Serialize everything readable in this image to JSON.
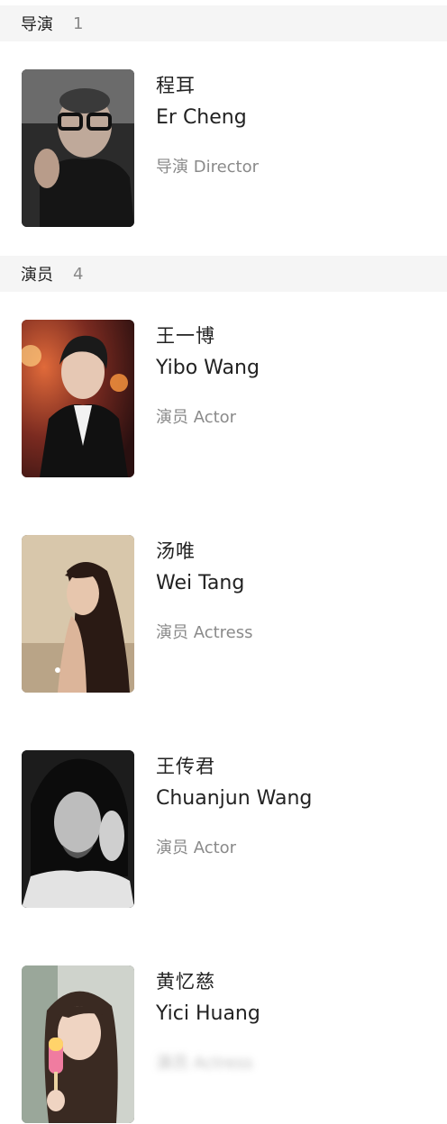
{
  "sections": [
    {
      "title": "导演",
      "count": "1",
      "people": [
        {
          "cn_name": "程耳",
          "en_name": "Er Cheng",
          "role": "导演 Director",
          "photo": "portrait-er-cheng"
        }
      ]
    },
    {
      "title": "演员",
      "count": "4",
      "people": [
        {
          "cn_name": "王一博",
          "en_name": "Yibo Wang",
          "role": "演员 Actor",
          "photo": "portrait-yibo-wang"
        },
        {
          "cn_name": "汤唯",
          "en_name": "Wei Tang",
          "role": "演员 Actress",
          "photo": "portrait-wei-tang"
        },
        {
          "cn_name": "王传君",
          "en_name": "Chuanjun Wang",
          "role": "演员 Actor",
          "photo": "portrait-chuanjun-wang"
        },
        {
          "cn_name": "黄忆慈",
          "en_name": "Yici Huang",
          "role": "演员 Actress",
          "photo": "portrait-yici-huang"
        }
      ]
    }
  ]
}
